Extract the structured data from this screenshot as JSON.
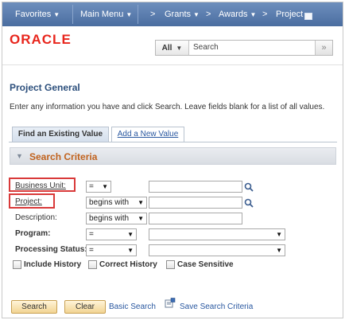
{
  "nav": {
    "favorites": "Favorites",
    "main_menu": "Main Menu",
    "crumb_sep": ">",
    "grants": "Grants",
    "awards": "Awards",
    "project": "Project"
  },
  "brand": {
    "logo_text": "ORACLE",
    "logo_color": "#e8251c"
  },
  "search": {
    "scope": "All",
    "placeholder": "Search",
    "go": "»"
  },
  "page": {
    "title": "Project General",
    "instructions": "Enter any information you have and click Search. Leave fields blank for a list of all values."
  },
  "tabs": [
    {
      "label": "Find an Existing Value",
      "active": true
    },
    {
      "label": "Add a New Value",
      "active": false
    }
  ],
  "criteria": {
    "label": "Search Criteria"
  },
  "fields": {
    "business_unit": {
      "label": "Business Unit:",
      "operator": "=",
      "value": ""
    },
    "project": {
      "label": "Project:",
      "operator": "begins with",
      "value": ""
    },
    "description": {
      "label": "Description:",
      "operator": "begins with",
      "value": ""
    },
    "program": {
      "label": "Program:",
      "operator": "=",
      "value": ""
    },
    "processing_status": {
      "label": "Processing Status:",
      "operator": "=",
      "value": ""
    }
  },
  "checkboxes": [
    {
      "label": "Include History",
      "checked": false
    },
    {
      "label": "Correct History",
      "checked": false
    },
    {
      "label": "Case Sensitive",
      "checked": false
    }
  ],
  "actions": {
    "search": "Search",
    "clear": "Clear",
    "basic_search": "Basic Search",
    "save_criteria": "Save Search Criteria"
  },
  "colors": {
    "nav_bg": "#5a7db0",
    "title": "#2c4f7c",
    "criteria_label": "#c1621d",
    "highlight": "#d93a3a",
    "link": "#2a58a0",
    "button_bg": "#f2d493"
  }
}
